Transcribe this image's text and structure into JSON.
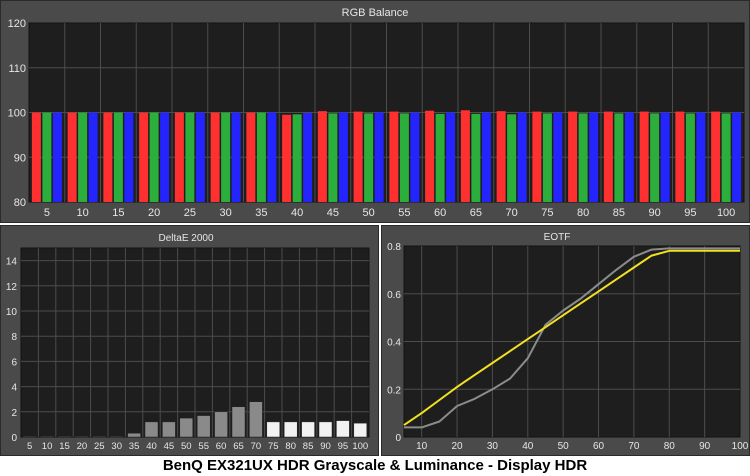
{
  "caption": "BenQ EX321UX HDR Grayscale & Luminance - Display HDR",
  "colors": {
    "panel_bg": "#4a4a4a",
    "plot_bg": "#1e1e1e",
    "grid": "#4c4c4c",
    "red": "#ff3030",
    "green": "#2cae3c",
    "blue": "#2424ff",
    "gray_bar": "#8a8a8a",
    "white_bar": "#f2f2f2",
    "eotf_target": "#f2e21e",
    "eotf_measured": "#8c8c8c"
  },
  "chart_data": [
    {
      "type": "bar",
      "title": "RGB Balance",
      "categories": [
        "5",
        "10",
        "15",
        "20",
        "25",
        "30",
        "35",
        "40",
        "45",
        "50",
        "55",
        "60",
        "65",
        "70",
        "75",
        "80",
        "85",
        "90",
        "95",
        "100"
      ],
      "ylim": [
        80,
        120
      ],
      "yticks": [
        "80",
        "90",
        "100",
        "110",
        "120"
      ],
      "series": [
        {
          "values": [
            100,
            100,
            100,
            100,
            100,
            100,
            100,
            99.5,
            100.3,
            100.2,
            100.2,
            100.4,
            100.5,
            100.3,
            100.2,
            100.2,
            100.2,
            100.2,
            100.2,
            100.2
          ]
        },
        {
          "values": [
            100,
            100,
            100,
            100,
            100,
            100,
            100,
            99.6,
            99.8,
            99.8,
            99.8,
            99.7,
            99.7,
            99.6,
            99.8,
            99.8,
            99.8,
            99.8,
            99.8,
            99.8
          ]
        },
        {
          "values": [
            100,
            100,
            100,
            100,
            100,
            100,
            100,
            99.9,
            100,
            100,
            100,
            100,
            100,
            100,
            100,
            100,
            100,
            100,
            100,
            100
          ]
        }
      ],
      "grid": true
    },
    {
      "type": "bar",
      "title": "DeltaE 2000",
      "categories": [
        "5",
        "10",
        "15",
        "20",
        "25",
        "30",
        "35",
        "40",
        "45",
        "50",
        "55",
        "60",
        "65",
        "70",
        "75",
        "80",
        "85",
        "90",
        "95",
        "100"
      ],
      "values": [
        0.05,
        0.05,
        0.05,
        0.05,
        0.05,
        0.05,
        0.3,
        1.2,
        1.2,
        1.5,
        1.7,
        2.0,
        2.4,
        2.8,
        1.2,
        1.2,
        1.2,
        1.2,
        1.3,
        1.1
      ],
      "ylim": [
        0,
        15
      ],
      "yticks": [
        "0",
        "2",
        "4",
        "6",
        "8",
        "10",
        "12",
        "14"
      ],
      "grid": true
    },
    {
      "type": "line",
      "title": "EOTF",
      "x": [
        5,
        10,
        15,
        20,
        25,
        30,
        35,
        40,
        45,
        50,
        55,
        60,
        65,
        70,
        75,
        80,
        85,
        90,
        95,
        100
      ],
      "xticks": [
        "10",
        "20",
        "30",
        "40",
        "50",
        "60",
        "70",
        "80",
        "90",
        "100"
      ],
      "yticks": [
        "0",
        "0.2",
        "0.4",
        "0.6",
        "0.8"
      ],
      "xlim": [
        5,
        100
      ],
      "ylim": [
        0,
        0.8
      ],
      "series": [
        {
          "values": [
            0.05,
            0.1,
            0.155,
            0.21,
            0.26,
            0.31,
            0.36,
            0.41,
            0.46,
            0.51,
            0.56,
            0.61,
            0.66,
            0.71,
            0.76,
            0.78,
            0.78,
            0.78,
            0.78,
            0.78
          ]
        },
        {
          "values": [
            0.04,
            0.04,
            0.065,
            0.13,
            0.16,
            0.2,
            0.245,
            0.33,
            0.47,
            0.53,
            0.58,
            0.64,
            0.7,
            0.755,
            0.785,
            0.79,
            0.79,
            0.79,
            0.79,
            0.79
          ]
        }
      ],
      "grid": true
    }
  ]
}
